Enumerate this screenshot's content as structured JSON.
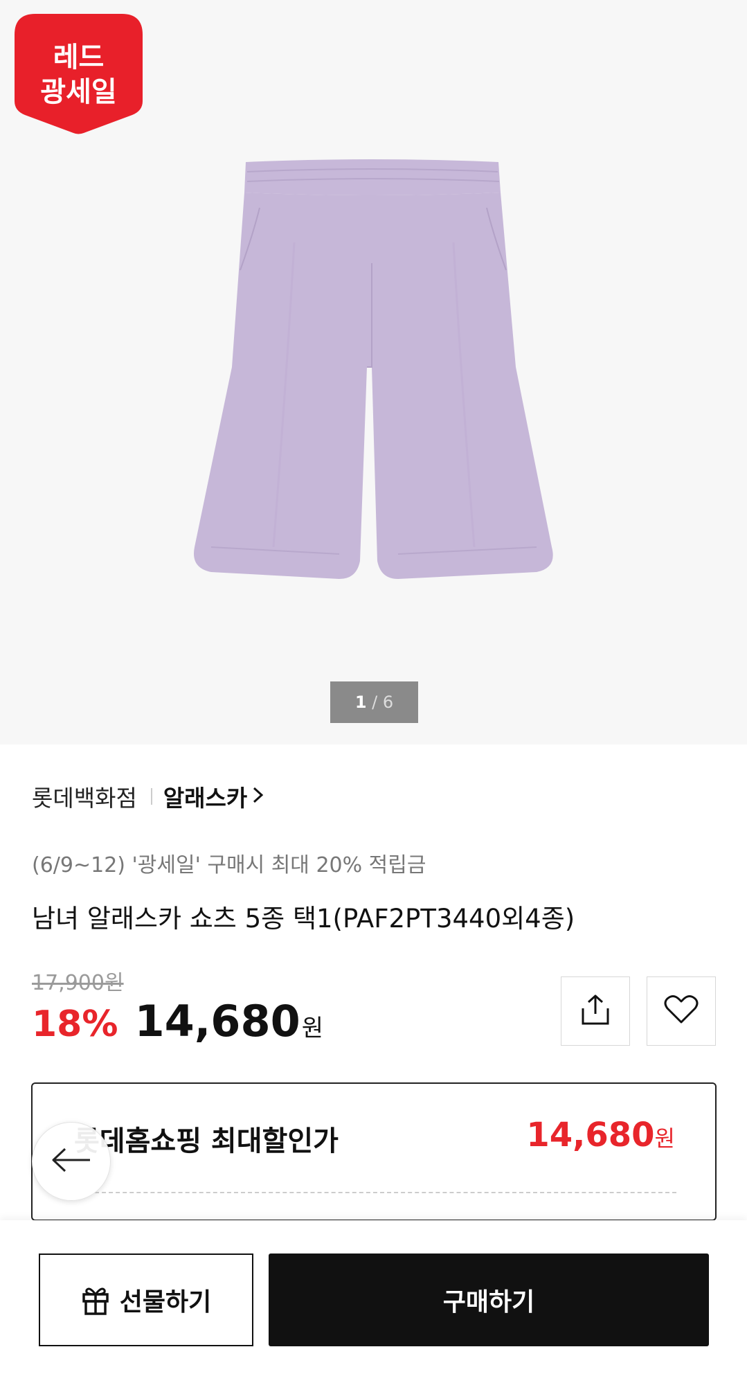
{
  "badge": {
    "line1": "레드",
    "line2": "광세일"
  },
  "gallery": {
    "current": "1",
    "sep": " / ",
    "total": "6"
  },
  "product": {
    "store": "롯데백화점",
    "brand": "알래스카",
    "brand_chevron": ">",
    "promo": "(6/9~12) '광세일' 구매시 최대 20% 적립금",
    "title": "남녀 알래스카 쇼츠 5종 택1(PAF2PT3440외4종)",
    "original_price": "17,900원",
    "discount_rate": "18%",
    "sale_price": "14,680",
    "currency": "원"
  },
  "deal": {
    "label": "롯데홈쇼핑 최대할인가",
    "price": "14,680",
    "currency": "원"
  },
  "actions": {
    "gift_label": "선물하기",
    "buy_label": "구매하기"
  },
  "icons": {
    "share": "share-icon",
    "wish": "heart-icon",
    "back": "arrow-left-icon",
    "gift": "gift-icon"
  },
  "colors": {
    "accent_red": "#e8252b",
    "badge_red": "#e8202a",
    "shorts_lavender": "#c4b5d6",
    "buy_button": "#111111"
  }
}
